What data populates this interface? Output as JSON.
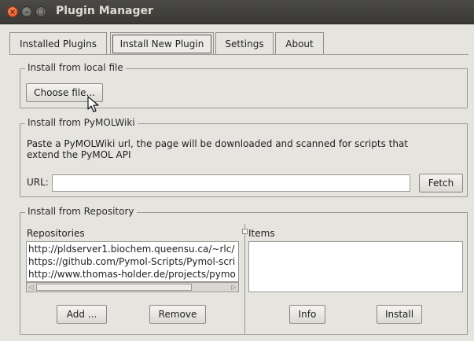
{
  "window": {
    "title": "Plugin Manager",
    "close_glyph": "×",
    "minimize_glyph": "–",
    "maximize_glyph": "□"
  },
  "tabs": [
    {
      "label": "Installed Plugins",
      "active": false
    },
    {
      "label": "Install New Plugin",
      "active": true
    },
    {
      "label": "Settings",
      "active": false
    },
    {
      "label": "About",
      "active": false
    }
  ],
  "local_file": {
    "legend": "Install from local file",
    "choose_label": "Choose file..."
  },
  "pymolwiki": {
    "legend": "Install from PyMOLWiki",
    "description_line1": "Paste a PyMOLWiki url, the page will be downloaded and scanned for scripts that",
    "description_line2": "extend the PyMOL API",
    "url_label": "URL:",
    "url_value": "",
    "fetch_label": "Fetch"
  },
  "repository": {
    "legend": "Install from Repository",
    "repositories_label": "Repositories",
    "repositories": [
      "http://pldserver1.biochem.queensu.ca/~rlc/",
      "https://github.com/Pymol-Scripts/Pymol-scri",
      "http://www.thomas-holder.de/projects/pymo"
    ],
    "items_label": "Items",
    "items": [],
    "add_label": "Add ...",
    "remove_label": "Remove",
    "info_label": "Info",
    "install_label": "Install",
    "scroll_left_glyph": "◁",
    "scroll_right_glyph": "▷"
  },
  "icons": {
    "cursor": "mouse-pointer-icon"
  },
  "colors": {
    "titlebar": "#3c3b37",
    "close_button": "#e95420",
    "window_bg": "#e6e4df"
  }
}
